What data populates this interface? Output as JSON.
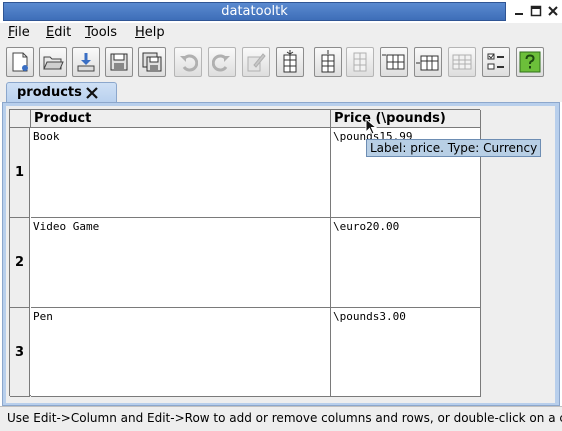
{
  "window": {
    "title": "datatooltk",
    "controls": [
      "minimize-icon",
      "maximize-icon",
      "close-icon"
    ]
  },
  "menu": {
    "items": [
      {
        "mnemonic": "F",
        "rest": "ile"
      },
      {
        "mnemonic": "E",
        "rest": "dit"
      },
      {
        "mnemonic": "T",
        "rest": "ools"
      },
      {
        "mnemonic": "H",
        "rest": "elp"
      }
    ]
  },
  "toolbar": {
    "icons": [
      "new-icon",
      "open-icon",
      "import-icon",
      "save-icon",
      "save-as-icon",
      "undo-icon",
      "redo-icon",
      "edit-cell-icon",
      "append-column-icon",
      "insert-column-icon",
      "remove-column-icon",
      "append-row-icon",
      "insert-row-icon",
      "remove-row-icon",
      "sort-icon",
      "help-icon"
    ],
    "disabled": [
      "undo-icon",
      "redo-icon",
      "edit-cell-icon",
      "remove-column-icon",
      "remove-row-icon"
    ]
  },
  "tabs": [
    {
      "label": "products"
    }
  ],
  "table": {
    "headers": [
      "Product",
      "Price (\\pounds)"
    ],
    "rows": [
      {
        "num": "1",
        "product": "Book",
        "price": "\\pounds15.99"
      },
      {
        "num": "2",
        "product": "Video Game",
        "price": "\\euro20.00"
      },
      {
        "num": "3",
        "product": "Pen",
        "price": "\\pounds3.00"
      }
    ]
  },
  "tooltip": {
    "text": "Label: price. Type: Currency"
  },
  "status": {
    "text": "Use Edit->Column and Edit->Row to add or remove columns and rows, or double-click on a cell to edit it."
  },
  "colors": {
    "title_bar": "#4a7cc5",
    "tab": "#c4d8f2",
    "tooltip": "#b8cfe5",
    "help_button": "#6cbf3a"
  }
}
